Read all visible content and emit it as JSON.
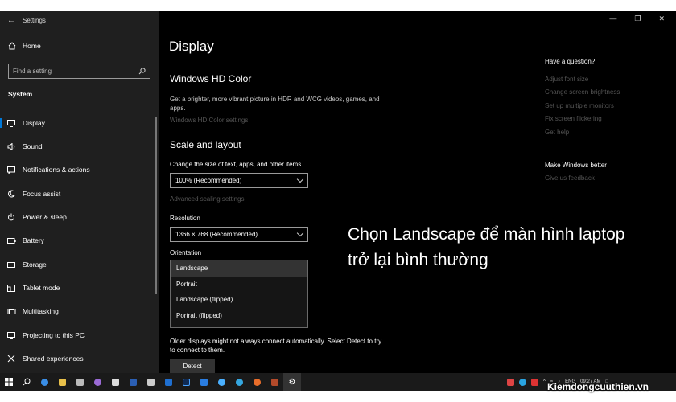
{
  "window": {
    "title": "Settings"
  },
  "sidebar": {
    "home": "Home",
    "search_placeholder": "Find a setting",
    "section": "System",
    "items": [
      {
        "label": "Display",
        "icon": "monitor-icon"
      },
      {
        "label": "Sound",
        "icon": "speaker-icon"
      },
      {
        "label": "Notifications & actions",
        "icon": "notification-icon"
      },
      {
        "label": "Focus assist",
        "icon": "moon-icon"
      },
      {
        "label": "Power & sleep",
        "icon": "power-icon"
      },
      {
        "label": "Battery",
        "icon": "battery-icon"
      },
      {
        "label": "Storage",
        "icon": "storage-icon"
      },
      {
        "label": "Tablet mode",
        "icon": "tablet-icon"
      },
      {
        "label": "Multitasking",
        "icon": "multitasking-icon"
      },
      {
        "label": "Projecting to this PC",
        "icon": "projecting-icon"
      },
      {
        "label": "Shared experiences",
        "icon": "shared-icon"
      }
    ]
  },
  "main": {
    "title": "Display",
    "hd_color": {
      "heading": "Windows HD Color",
      "desc": "Get a brighter, more vibrant picture in HDR and WCG videos, games, and apps.",
      "link": "Windows HD Color settings"
    },
    "scale": {
      "heading": "Scale and layout",
      "size_label": "Change the size of text, apps, and other items",
      "size_value": "100% (Recommended)",
      "advanced_link": "Advanced scaling settings",
      "resolution_label": "Resolution",
      "resolution_value": "1366 × 768 (Recommended)",
      "orientation_label": "Orientation",
      "orientation_options": [
        "Landscape",
        "Portrait",
        "Landscape (flipped)",
        "Portrait (flipped)"
      ]
    },
    "detect": {
      "text": "Older displays might not always connect automatically. Select Detect to try to connect to them.",
      "button": "Detect"
    }
  },
  "right": {
    "question_heading": "Have a question?",
    "question_links": [
      "Adjust font size",
      "Change screen brightness",
      "Set up multiple monitors",
      "Fix screen flickering",
      "Get help"
    ],
    "better_heading": "Make Windows better",
    "feedback_link": "Give us feedback"
  },
  "overlay_text": "Chọn Landscape để màn hình laptop trở lại bình thường",
  "taskbar": {
    "lang": "ENG",
    "time": "09:27 AM"
  },
  "watermark": "Kiemdongcuuthien.vn",
  "colors": {
    "accent": "#0078d7",
    "background": "#000000",
    "sidebar": "#1f1f1f"
  }
}
